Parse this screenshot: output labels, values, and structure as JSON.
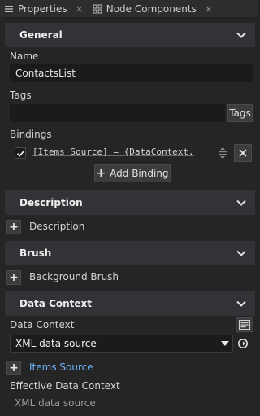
{
  "tabs": [
    {
      "label": "Properties",
      "icon": "list-icon",
      "close": "×"
    },
    {
      "label": "Node Components",
      "icon": "components-icon",
      "close": "×"
    }
  ],
  "general": {
    "header": "General",
    "name_label": "Name",
    "name_value": "ContactsList",
    "tags_label": "Tags",
    "tags_value": "",
    "tags_button": "Tags",
    "bindings_label": "Bindings",
    "binding_expr": "[Items Source] = {DataContext.",
    "add_binding_label": "Add Binding"
  },
  "description": {
    "header": "Description",
    "row_label": "Description"
  },
  "brush": {
    "header": "Brush",
    "row_label": "Background Brush"
  },
  "data_context": {
    "header": "Data Context",
    "field_label": "Data Context",
    "selected": "XML data source",
    "items_source_label": "Items Source",
    "effective_label": "Effective Data Context",
    "effective_value": "XML data source"
  },
  "colors": {
    "background": "#252526",
    "header_bg": "#333337",
    "input_bg": "#1b1b1c",
    "link": "#6fb4ff"
  }
}
